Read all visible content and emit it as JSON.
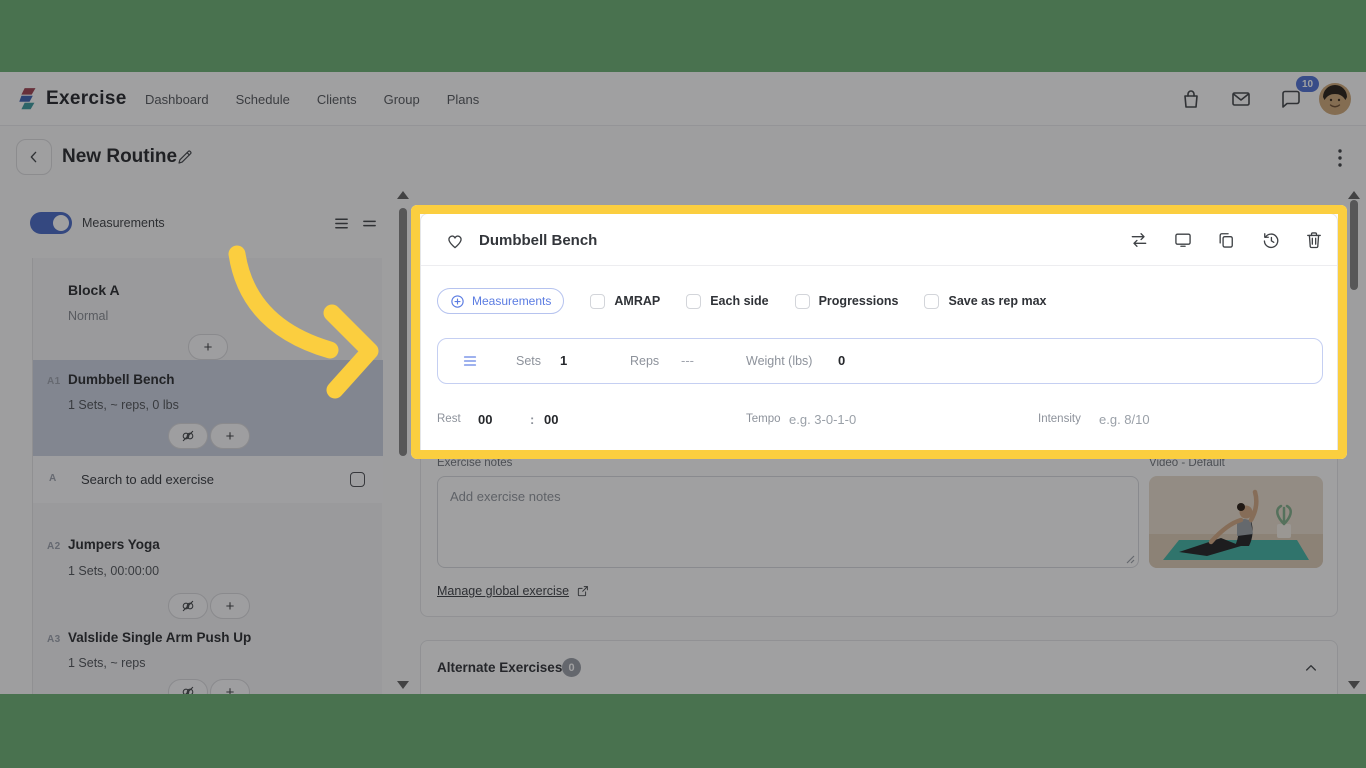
{
  "colors": {
    "accent_blue": "#4C6FD6",
    "highlight_yellow": "#FBCE3F",
    "frame_green": "#49724F",
    "badge_blue": "#4C6FD4",
    "selected_item_bg": "#CCD3E2"
  },
  "navbar": {
    "brand": "Exercise",
    "links": [
      "Dashboard",
      "Schedule",
      "Clients",
      "Group",
      "Plans"
    ],
    "chat_badge": "10"
  },
  "header": {
    "title": "New Routine"
  },
  "sidebar": {
    "measurements_toggle_label": "Measurements",
    "block_title": "Block A",
    "block_type": "Normal",
    "items": [
      {
        "tag": "A1",
        "name": "Dumbbell Bench",
        "detail": "1 Sets, ~ reps, 0 lbs"
      },
      {
        "tag": "A",
        "name": "Search to add exercise",
        "detail": ""
      },
      {
        "tag": "A2",
        "name": "Jumpers Yoga",
        "detail": "1 Sets, 00:00:00"
      },
      {
        "tag": "A3",
        "name": "Valslide Single Arm Push Up",
        "detail": "1 Sets, ~ reps"
      }
    ]
  },
  "detail": {
    "title": "Dumbbell Bench",
    "measurements_button": "Measurements",
    "checkboxes": [
      "AMRAP",
      "Each side",
      "Progressions",
      "Save as rep max"
    ],
    "set_row": {
      "sets_label": "Sets",
      "sets_value": "1",
      "reps_label": "Reps",
      "reps_value": "---",
      "weight_label": "Weight (lbs)",
      "weight_value": "0"
    },
    "rest_label": "Rest",
    "rest_min": "00",
    "rest_colon": ":",
    "rest_sec": "00",
    "tempo_label": "Tempo",
    "tempo_placeholder": "e.g. 3-0-1-0",
    "intensity_label": "Intensity",
    "intensity_placeholder": "e.g. 8/10",
    "notes_label": "Exercise notes",
    "notes_placeholder": "Add exercise notes",
    "video_label": "Video - Default",
    "manage_link": "Manage global exercise"
  },
  "alternate": {
    "title": "Alternate Exercises",
    "count": "0"
  },
  "icons": {
    "cart": "shopping-bag",
    "messages": "envelope",
    "chat": "chat-bubble",
    "back": "chevron-left",
    "edit": "pencil",
    "more": "kebab-vertical",
    "favorite": "heart-outline",
    "swap": "swap-horizontal",
    "screen": "monitor",
    "duplicate": "copy",
    "history": "clock-restore",
    "delete": "trash",
    "unlink": "broken-link",
    "add": "plus",
    "reorder": "menu-lines",
    "external": "external-link",
    "collapse": "chevron-up",
    "scroll_up": "triangle-up",
    "scroll_down": "triangle-down"
  }
}
